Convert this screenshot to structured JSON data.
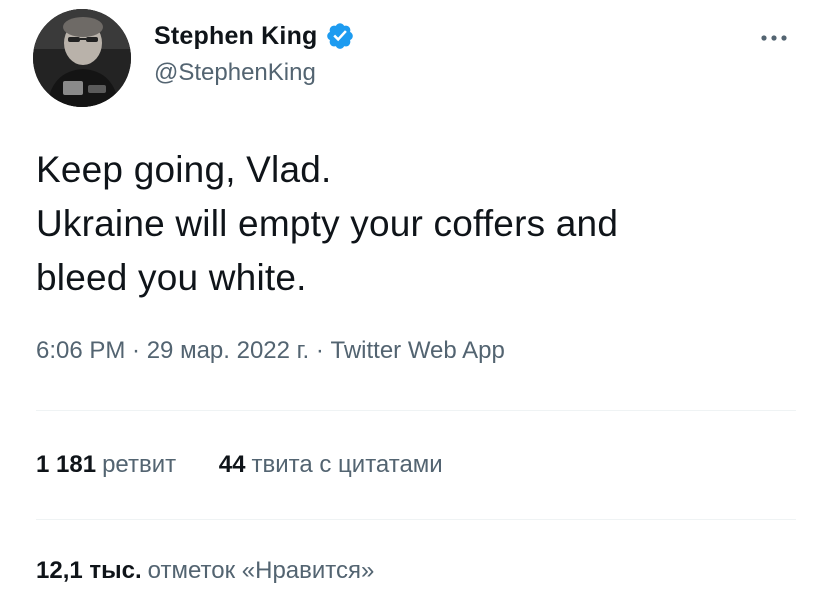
{
  "author": {
    "display_name": "Stephen King",
    "handle": "@StephenKing",
    "verified": true,
    "verified_color": "#1d9bf0"
  },
  "icons": {
    "verified": "verified-badge-icon",
    "more": "more-options-icon",
    "avatar": "profile-photo"
  },
  "tweet": {
    "lines": [
      "Keep going, Vlad.",
      "Ukraine will empty your coffers and",
      "bleed you white."
    ],
    "meta": "6:06 PM · 29 мар. 2022 г. · Twitter Web App"
  },
  "stats": {
    "retweets_count": "1 181",
    "retweets_label": "ретвит",
    "quotes_count": "44",
    "quotes_label": "твита с цитатами",
    "likes_count": "12,1 тыс.",
    "likes_label": "отметок «Нравится»"
  },
  "colors": {
    "text": "#0f1419",
    "secondary": "#536471",
    "divider": "#eff3f4"
  }
}
